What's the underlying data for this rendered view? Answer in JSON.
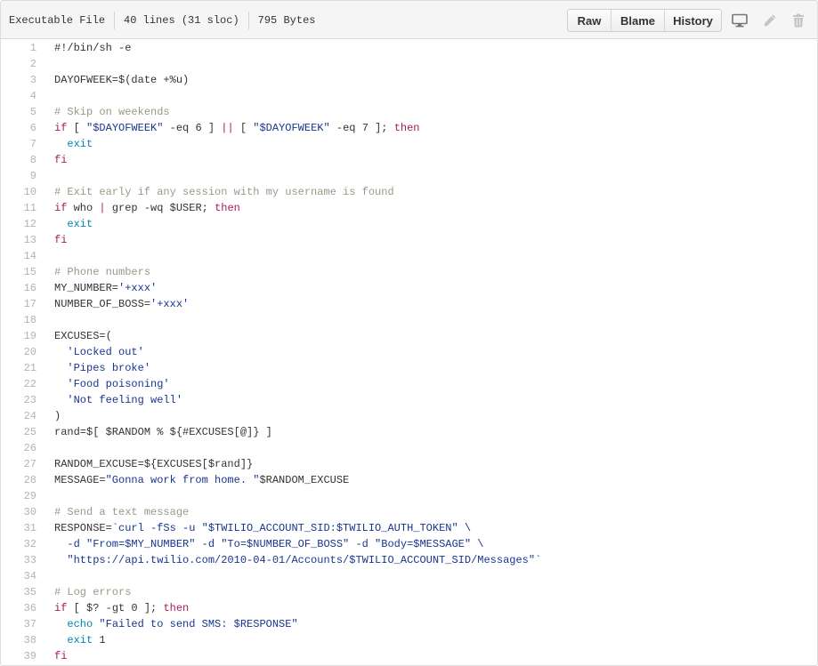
{
  "file_info": {
    "mode": "Executable File",
    "lines": "40 lines (31 sloc)",
    "size": "795 Bytes"
  },
  "actions": {
    "raw": "Raw",
    "blame": "Blame",
    "history": "History"
  },
  "icons": {
    "desktop": "desktop-icon",
    "edit": "pencil-icon",
    "delete": "trash-icon"
  },
  "colors": {
    "comment": "#999988",
    "keyword": "#a71d5d",
    "string": "#183691",
    "builtin": "#0086b3",
    "line_number": "#b3b3b3"
  },
  "code_lines": [
    [
      [
        "",
        "#!/bin/sh -e"
      ]
    ],
    [],
    [
      [
        "",
        "DAYOFWEEK=$("
      ],
      [
        "",
        "date +%u"
      ],
      [
        "",
        ")"
      ]
    ],
    [],
    [
      [
        "cm",
        "# Skip on weekends"
      ]
    ],
    [
      [
        "kw",
        "if"
      ],
      [
        "",
        " [ "
      ],
      [
        "st",
        "\"$DAYOFWEEK\""
      ],
      [
        "",
        " -eq 6 ] "
      ],
      [
        "op",
        "||"
      ],
      [
        "",
        " [ "
      ],
      [
        "st",
        "\"$DAYOFWEEK\""
      ],
      [
        "",
        " -eq 7 ]; "
      ],
      [
        "kw",
        "then"
      ]
    ],
    [
      [
        "",
        "  "
      ],
      [
        "nb",
        "exit"
      ]
    ],
    [
      [
        "kw",
        "fi"
      ]
    ],
    [],
    [
      [
        "cm",
        "# Exit early if any session with my username is found"
      ]
    ],
    [
      [
        "kw",
        "if"
      ],
      [
        "",
        " who "
      ],
      [
        "op",
        "|"
      ],
      [
        "",
        " grep -wq "
      ],
      [
        "",
        "$USER"
      ],
      [
        "",
        "; "
      ],
      [
        "kw",
        "then"
      ]
    ],
    [
      [
        "",
        "  "
      ],
      [
        "nb",
        "exit"
      ]
    ],
    [
      [
        "kw",
        "fi"
      ]
    ],
    [],
    [
      [
        "cm",
        "# Phone numbers"
      ]
    ],
    [
      [
        "",
        "MY_NUMBER="
      ],
      [
        "st",
        "'+xxx'"
      ]
    ],
    [
      [
        "",
        "NUMBER_OF_BOSS="
      ],
      [
        "st",
        "'+xxx'"
      ]
    ],
    [],
    [
      [
        "",
        "EXCUSES=("
      ]
    ],
    [
      [
        "",
        "  "
      ],
      [
        "st",
        "'Locked out'"
      ]
    ],
    [
      [
        "",
        "  "
      ],
      [
        "st",
        "'Pipes broke'"
      ]
    ],
    [
      [
        "",
        "  "
      ],
      [
        "st",
        "'Food poisoning'"
      ]
    ],
    [
      [
        "",
        "  "
      ],
      [
        "st",
        "'Not feeling well'"
      ]
    ],
    [
      [
        "",
        ")"
      ]
    ],
    [
      [
        "",
        "rand=$[ $RANDOM % ${#EXCUSES[@]} ]"
      ]
    ],
    [],
    [
      [
        "",
        "RANDOM_EXCUSE=${EXCUSES[$rand]}"
      ]
    ],
    [
      [
        "",
        "MESSAGE="
      ],
      [
        "st",
        "\"Gonna work from home. \""
      ],
      [
        "",
        "$RANDOM_EXCUSE"
      ]
    ],
    [],
    [
      [
        "cm",
        "# Send a text message"
      ]
    ],
    [
      [
        "",
        "RESPONSE="
      ],
      [
        "st",
        "`curl -fSs -u \"$TWILIO_ACCOUNT_SID:$TWILIO_AUTH_TOKEN\" \\"
      ]
    ],
    [
      [
        "st",
        "  -d \"From=$MY_NUMBER\" -d \"To=$NUMBER_OF_BOSS\" -d \"Body=$MESSAGE\" \\"
      ]
    ],
    [
      [
        "st",
        "  \"https://api.twilio.com/2010-04-01/Accounts/$TWILIO_ACCOUNT_SID/Messages\"`"
      ]
    ],
    [],
    [
      [
        "cm",
        "# Log errors"
      ]
    ],
    [
      [
        "kw",
        "if"
      ],
      [
        "",
        " [ $? -gt 0 ]; "
      ],
      [
        "kw",
        "then"
      ]
    ],
    [
      [
        "",
        "  "
      ],
      [
        "nb",
        "echo"
      ],
      [
        "",
        " "
      ],
      [
        "st",
        "\"Failed to send SMS: $RESPONSE\""
      ]
    ],
    [
      [
        "",
        "  "
      ],
      [
        "nb",
        "exit"
      ],
      [
        "",
        " 1"
      ]
    ],
    [
      [
        "kw",
        "fi"
      ]
    ]
  ]
}
